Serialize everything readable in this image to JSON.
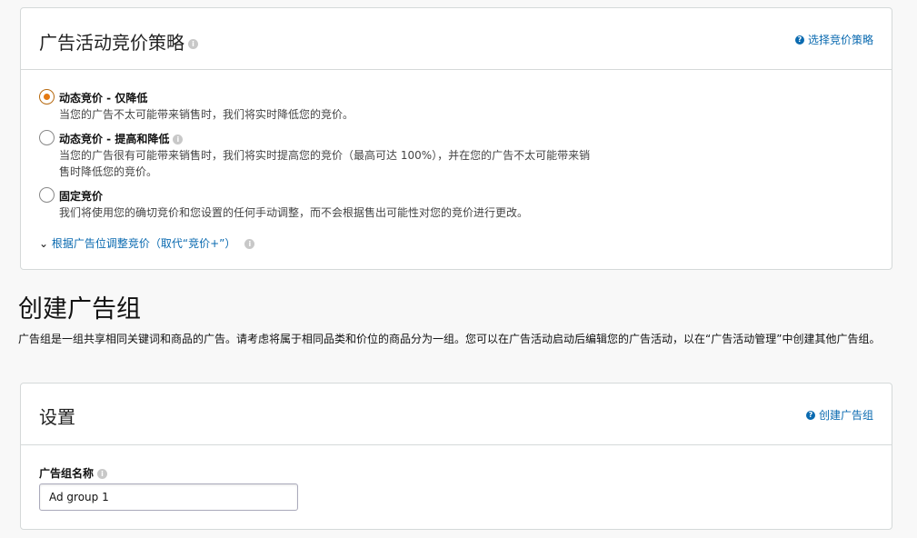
{
  "bidding": {
    "title": "广告活动竞价策略",
    "help_link": "选择竞价策略",
    "options": [
      {
        "label": "动态竞价 - 仅降低",
        "desc": "当您的广告不太可能带来销售时，我们将实时降低您的竞价。",
        "selected": true
      },
      {
        "label": "动态竞价 - 提高和降低",
        "desc": "当您的广告很有可能带来销售时，我们将实时提高您的竞价（最高可达 100%），并在您的广告不太可能带来销售时降低您的竞价。",
        "selected": false
      },
      {
        "label": "固定竞价",
        "desc": "我们将使用您的确切竞价和您设置的任何手动调整，而不会根据售出可能性对您的竞价进行更改。",
        "selected": false
      }
    ],
    "placement_link": "根据广告位调整竞价（取代“竞价+”）"
  },
  "create_group": {
    "title": "创建广告组",
    "desc": "广告组是一组共享相同关键词和商品的广告。请考虑将属于相同品类和价位的商品分为一组。您可以在广告活动启动后编辑您的广告活动，以在“广告活动管理”中创建其他广告组。"
  },
  "settings": {
    "title": "设置",
    "help_link": "创建广告组",
    "name_label": "广告组名称",
    "name_value": "Ad group 1"
  }
}
